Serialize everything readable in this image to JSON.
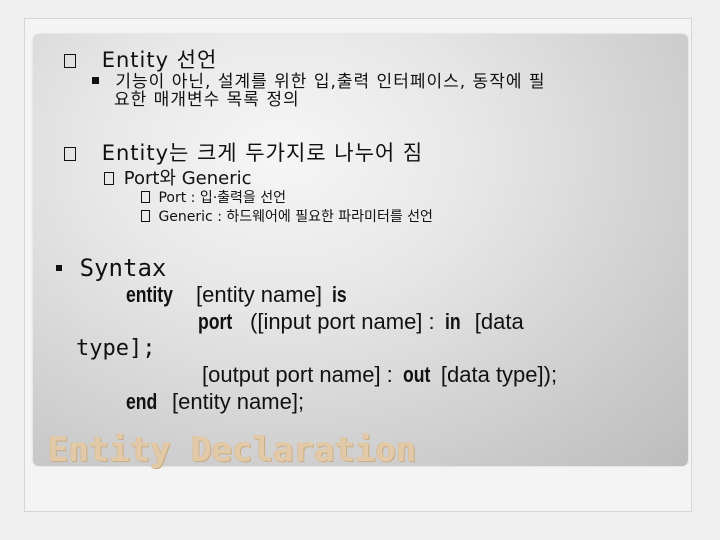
{
  "bullet1": {
    "text": "Entity 선언",
    "sub_line1": "기능이 아닌, 설계를 위한 입,출력 인터페이스, 동작에 필",
    "sub_line2": "요한 매개변수 목록 정의"
  },
  "bullet2": {
    "text": "Entity는 크게 두가지로 나누어 짐",
    "sub": "Port와 Generic",
    "subsub": [
      "Port : 입·출력을 선언",
      "Generic : 하드웨어에 필요한 파라미터를 선언"
    ]
  },
  "syntax": {
    "label": "Syntax",
    "line1_kw": "entity",
    "line1_text": "[entity name]",
    "line1_kw2": "is",
    "line2_kw": "port",
    "line2_text": "([input port name] :",
    "line2_kw2": "in",
    "line2_text2": "[data",
    "line3_text": "type];",
    "line4_text": "[output port name] :",
    "line4_kw": "out",
    "line4_text2": "[data type]);",
    "line5_kw": "end",
    "line5_text": "[entity name];"
  },
  "title": "Entity Declaration"
}
